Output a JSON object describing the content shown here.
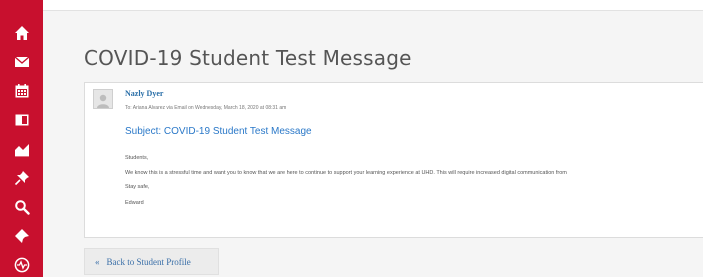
{
  "sidebar": {
    "items": [
      {
        "icon": "home-icon"
      },
      {
        "icon": "mail-icon"
      },
      {
        "icon": "calendar-icon"
      },
      {
        "icon": "book-icon"
      },
      {
        "icon": "chart-icon"
      },
      {
        "icon": "pin-icon"
      },
      {
        "icon": "search-icon"
      },
      {
        "icon": "bookmark-icon"
      },
      {
        "icon": "activity-icon"
      }
    ]
  },
  "page": {
    "title": "COVID-19 Student Test Message"
  },
  "message": {
    "sender": "Nazly Dyer",
    "meta": "To: Ariana Alvarez  via Email  on Wednesday, March 18, 2020 at 08:31 am",
    "subject": "Subject: COVID-19 Student Test Message",
    "greeting": "Students,",
    "body": "We know this is a stressful time and want you to know that we are here to continue to support your learning experience at UHD. This will require increased digital communication from",
    "closing": "Stay safe,",
    "signature": "Edward"
  },
  "actions": {
    "back_label": "Back to Student Profile",
    "back_arrow": "«"
  },
  "colors": {
    "sidebar": "#c8102e",
    "link": "#2a78c8",
    "title": "#555555"
  }
}
